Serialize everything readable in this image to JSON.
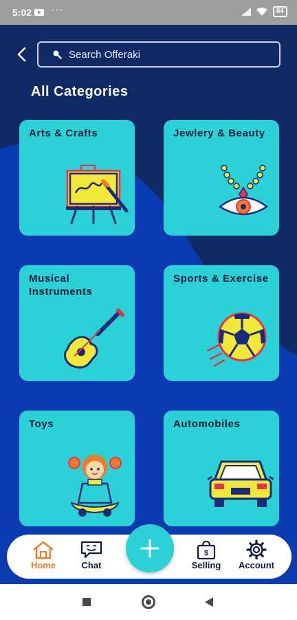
{
  "status_bar": {
    "time": "5:02",
    "battery": "64",
    "icons": [
      "youtube-icon",
      "more-dots-icon",
      "signal-icon",
      "wifi-icon",
      "battery-icon"
    ]
  },
  "header": {
    "search_placeholder": "Search Offeraki",
    "title": "All Categories"
  },
  "categories": [
    {
      "label": "Arts & Crafts",
      "icon": "easel-icon"
    },
    {
      "label": "Jewlery & Beauty",
      "icon": "necklace-eye-icon"
    },
    {
      "label": "Musical Instruments",
      "icon": "guitar-icon"
    },
    {
      "label": "Sports & Exercise",
      "icon": "soccer-ball-icon"
    },
    {
      "label": "Toys",
      "icon": "doll-icon"
    },
    {
      "label": "Automobiles",
      "icon": "car-icon"
    }
  ],
  "bottom_nav": {
    "items": [
      {
        "label": "Home",
        "icon": "home-icon",
        "active": true
      },
      {
        "label": "Chat",
        "icon": "chat-icon",
        "active": false
      },
      {
        "label": "Selling",
        "icon": "shopping-bag-icon",
        "active": false
      },
      {
        "label": "Account",
        "icon": "gear-icon",
        "active": false
      }
    ],
    "fab_icon": "plus-icon"
  },
  "colors": {
    "background": "#102a66",
    "card": "#2ad1d6",
    "active": "#f07b2c",
    "text_dark": "#0d1a3a"
  }
}
